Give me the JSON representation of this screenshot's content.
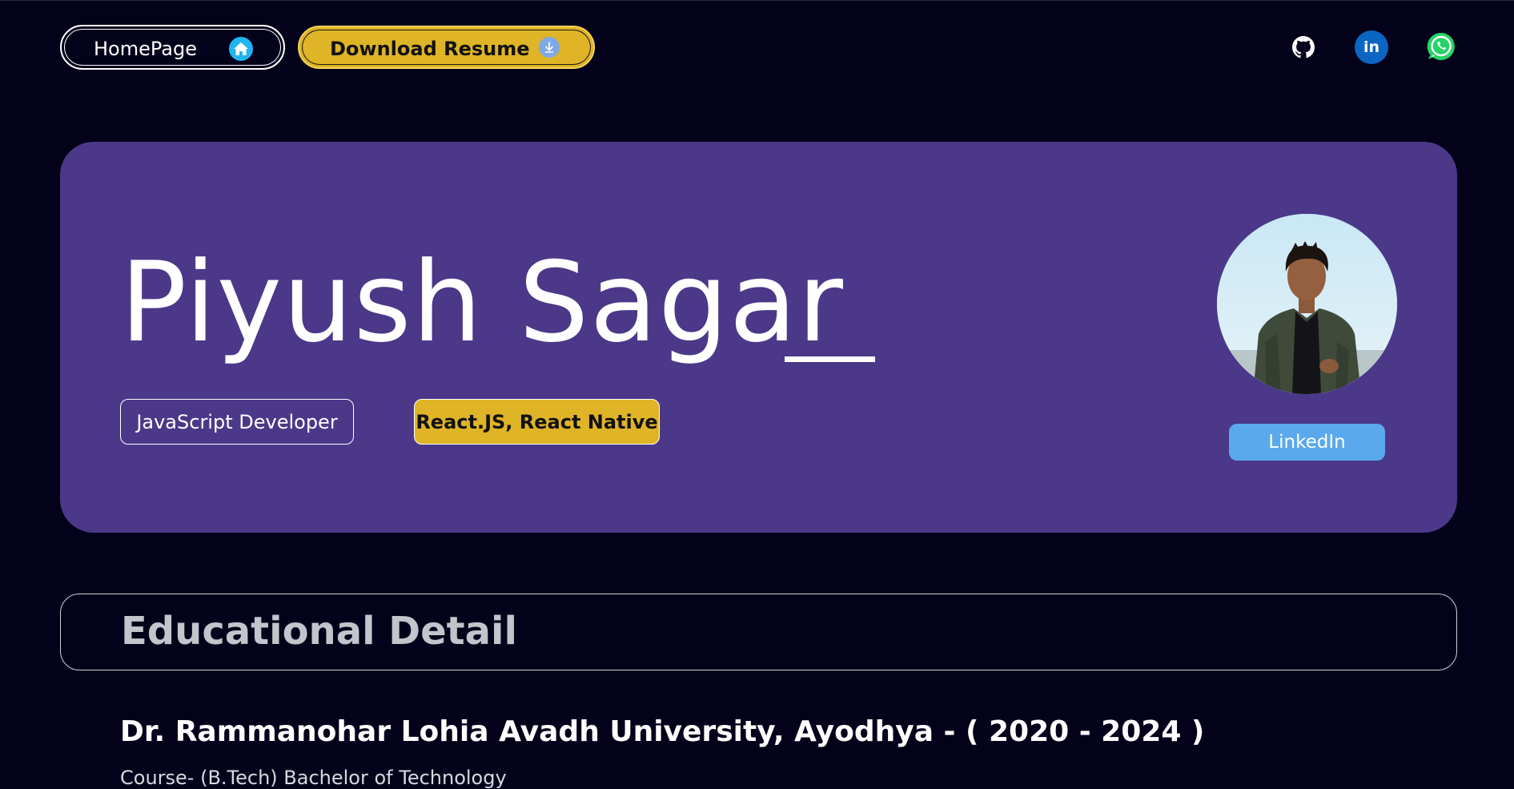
{
  "nav": {
    "home_label": "HomePage",
    "home_icon": "home-icon",
    "resume_label": "Download Resume",
    "resume_icon": "download-icon"
  },
  "social": [
    {
      "name": "github",
      "icon": "github-icon"
    },
    {
      "name": "linkedin",
      "icon": "linkedin-icon",
      "text": "in"
    },
    {
      "name": "whatsapp",
      "icon": "whatsapp-icon"
    }
  ],
  "hero": {
    "name": "Piyush Sagar",
    "role": "JavaScript Developer",
    "skills": "React.JS, React Native",
    "linkedin_button": "LinkedIn"
  },
  "education": {
    "section_title": "Educational Detail",
    "university": "Dr. Rammanohar Lohia Avadh University, Ayodhya - ( 2020 - 2024 )",
    "course": "Course- (B.Tech) Bachelor of Technology"
  },
  "colors": {
    "background": "#03021a",
    "hero_card": "#4b3889",
    "accent_gold": "#dfb427",
    "linkedin_blue": "#5aa9ec"
  }
}
